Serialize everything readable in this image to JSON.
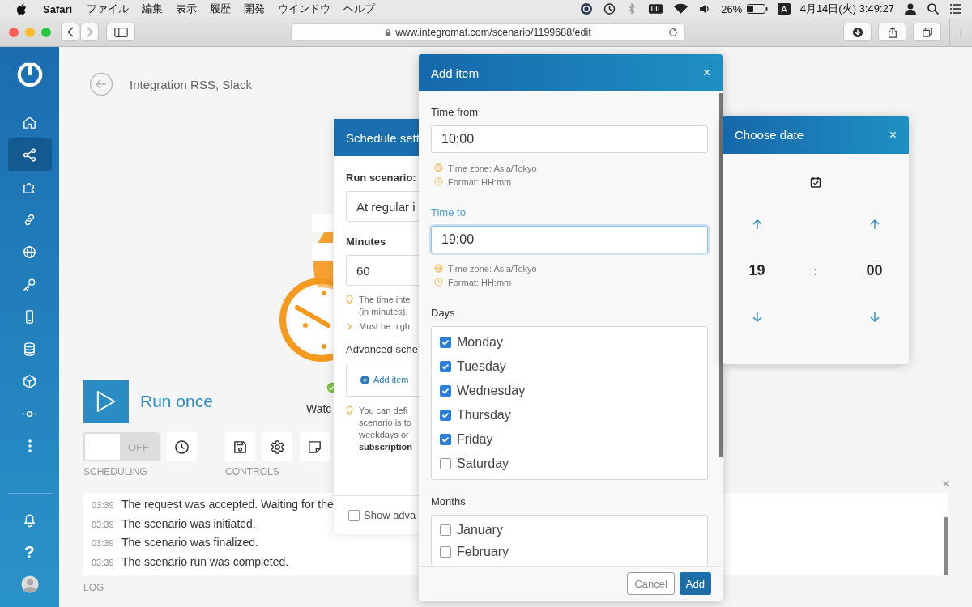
{
  "menubar": {
    "app": "Safari",
    "menus": [
      "ファイル",
      "編集",
      "表示",
      "履歴",
      "開発",
      "ウインドウ",
      "ヘルプ"
    ],
    "battery": "26%",
    "input_source": "A",
    "clock": "4月14日(火) 3:49:27"
  },
  "browser": {
    "url": "www.integromat.com/scenario/1199688/edit"
  },
  "sidebar": {
    "items": [
      {
        "kind": "home",
        "selected": false
      },
      {
        "kind": "share",
        "selected": true
      },
      {
        "kind": "puzzle",
        "selected": false
      },
      {
        "kind": "link",
        "selected": false
      },
      {
        "kind": "globe",
        "selected": false
      },
      {
        "kind": "key",
        "selected": false
      },
      {
        "kind": "phone",
        "selected": false
      },
      {
        "kind": "database",
        "selected": false
      },
      {
        "kind": "cube",
        "selected": false
      },
      {
        "kind": "connector",
        "selected": false
      },
      {
        "kind": "more",
        "selected": false
      }
    ],
    "help": "?"
  },
  "scenario": {
    "title": "Integration RSS, Slack",
    "run_label": "Run once",
    "module_label": "Watc",
    "scheduling": {
      "on": false,
      "label": "OFF"
    },
    "scheduling_caption": "SCHEDULING",
    "controls_caption": "CONTROLS"
  },
  "log": {
    "close": "×",
    "caption": "LOG",
    "entries": [
      {
        "time": "03:39",
        "message": "The request was accepted. Waiting for the"
      },
      {
        "time": "03:39",
        "message": "The scenario was initiated."
      },
      {
        "time": "03:39",
        "message": "The scenario was finalized."
      },
      {
        "time": "03:39",
        "message": "The scenario run was completed."
      }
    ]
  },
  "schedule_panel": {
    "title": "Schedule sett",
    "run_label": "Run scenario:",
    "run_value": "At regular i",
    "minutes_label": "Minutes",
    "minutes_value": "60",
    "interval_hint": [
      "The time inte",
      "(in minutes)."
    ],
    "range_hint": "Must be high",
    "advanced_label": "Advanced sche",
    "add_item": "Add item",
    "advanced_hint": [
      "You can defi",
      "scenario is to",
      "weekdays or",
      "subscription"
    ],
    "show_advanced": {
      "label": "Show adva",
      "checked": false
    }
  },
  "add_dialog": {
    "title": "Add item",
    "close": "×",
    "fields": [
      {
        "label": "Time from",
        "value": "10:00",
        "focused": false,
        "hints": [
          {
            "kind": "timezone",
            "text": "Time zone: Asia/Tokyo"
          },
          {
            "kind": "format",
            "text": "Format: HH:mm"
          }
        ]
      },
      {
        "label": "Time to",
        "value": "19:00",
        "focused": true,
        "hints": [
          {
            "kind": "timezone",
            "text": "Time zone: Asia/Tokyo"
          },
          {
            "kind": "format",
            "text": "Format: HH:mm"
          }
        ]
      }
    ],
    "days": {
      "label": "Days",
      "items": [
        {
          "label": "Monday",
          "checked": true
        },
        {
          "label": "Tuesday",
          "checked": true
        },
        {
          "label": "Wednesday",
          "checked": true
        },
        {
          "label": "Thursday",
          "checked": true
        },
        {
          "label": "Friday",
          "checked": true
        },
        {
          "label": "Saturday",
          "checked": false
        }
      ]
    },
    "months": {
      "label": "Months",
      "items": [
        {
          "label": "January",
          "checked": false
        },
        {
          "label": "February",
          "checked": false
        }
      ]
    },
    "buttons": {
      "cancel": "Cancel",
      "add": "Add"
    }
  },
  "time_picker": {
    "title": "Choose date",
    "close": "×",
    "hour": "19",
    "separator": ":",
    "minute": "00"
  }
}
